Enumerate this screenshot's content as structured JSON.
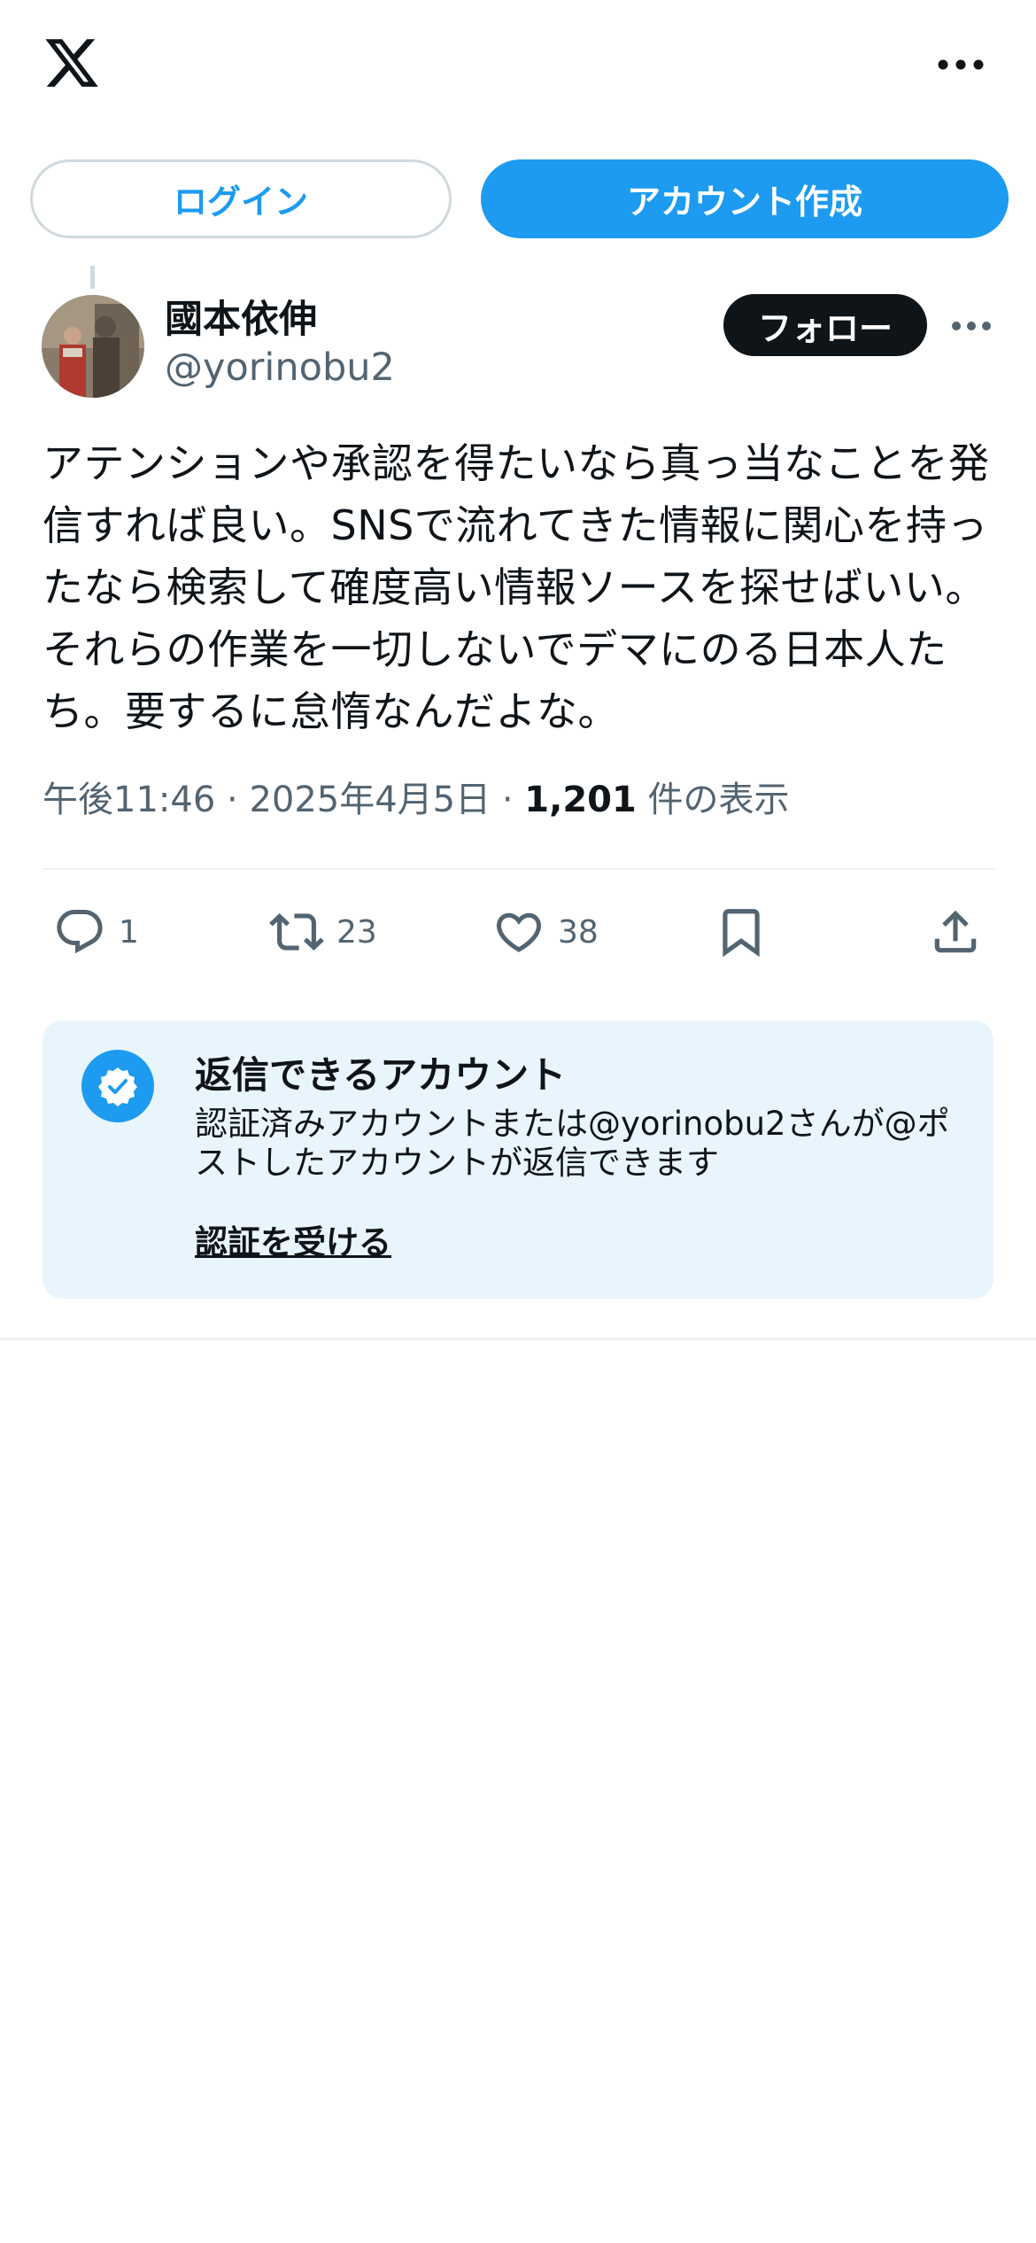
{
  "header": {
    "logo_icon": "x-logo-icon",
    "more_icon": "more-horizontal-icon"
  },
  "auth": {
    "login_label": "ログイン",
    "signup_label": "アカウント作成"
  },
  "post": {
    "author_name": "國本依伸",
    "author_handle": "@yorinobu2",
    "follow_label": "フォロー",
    "text": "アテンションや承認を得たいなら真っ当なことを発信すれば良い。SNSで流れてきた情報に関心を持ったなら検索して確度高い情報ソースを探せばいい。それらの作業を一切しないでデマにのる日本人たち。要するに怠惰なんだよな。",
    "time": "午後11:46",
    "separator": "·",
    "date": "2025年4月5日",
    "views_count": "1,201",
    "views_label": "件の表示"
  },
  "actions": {
    "reply_count": "1",
    "repost_count": "23",
    "like_count": "38"
  },
  "reply_restriction": {
    "title": "返信できるアカウント",
    "description": "認証済みアカウントまたは@yorinobu2さんが@ポストしたアカウントが返信できます",
    "link_label": "認証を受ける"
  },
  "colors": {
    "accent": "#1d9bf0",
    "text_primary": "#0f1419",
    "text_secondary": "#536471",
    "card_background": "#e8f5fd"
  }
}
